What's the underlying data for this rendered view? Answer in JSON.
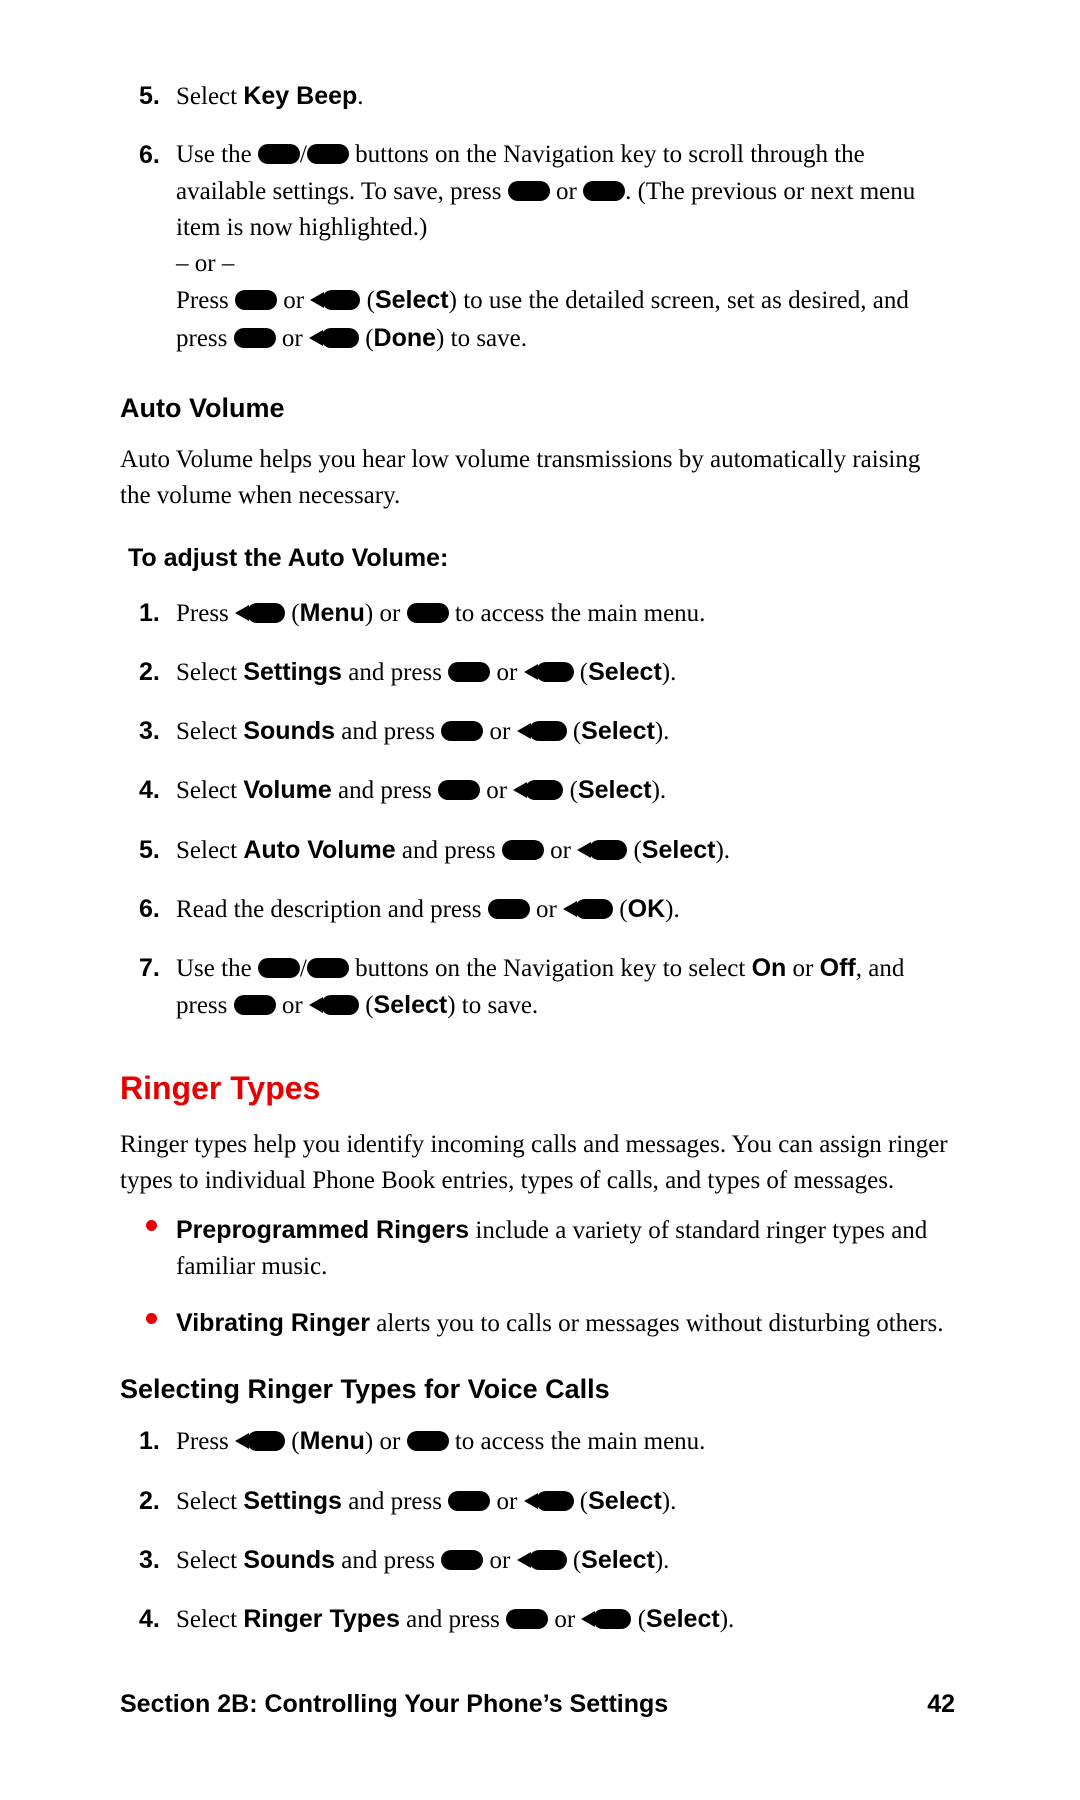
{
  "steps_cont": [
    {
      "n": "5.",
      "parts": [
        "Select ",
        "*Key Beep*",
        "."
      ]
    },
    {
      "n": "6.",
      "parts": [
        "Use the ",
        "@oval",
        "/",
        "@oval",
        " buttons on the Navigation key to scroll through the available settings. To save, press ",
        "@oval",
        " or ",
        "@oval",
        ". (The previous or next menu item is now highlighted.)\n– or –\nPress ",
        "@oval",
        " or ",
        "@nav",
        " (",
        "*Select*",
        ") to use the detailed screen, set as desired, and press ",
        "@oval",
        " or ",
        "@nav",
        " (",
        "*Done*",
        ") to save."
      ]
    }
  ],
  "auto_volume": {
    "heading": "Auto Volume",
    "intro": "Auto Volume helps you hear low volume transmissions by automatically raising the volume when necessary.",
    "task": "To adjust the Auto Volume:",
    "steps": [
      {
        "n": "1.",
        "parts": [
          "Press ",
          "@nav",
          " (",
          "*Menu*",
          ") or ",
          "@oval",
          " to access the main menu."
        ]
      },
      {
        "n": "2.",
        "parts": [
          "Select ",
          "*Settings*",
          " and press ",
          "@oval",
          " or ",
          "@nav",
          " (",
          "*Select*",
          ")."
        ]
      },
      {
        "n": "3.",
        "parts": [
          "Select ",
          "*Sounds*",
          " and press ",
          "@oval",
          " or ",
          "@nav",
          " (",
          "*Select*",
          ")."
        ]
      },
      {
        "n": "4.",
        "parts": [
          "Select ",
          "*Volume*",
          " and press ",
          "@oval",
          " or ",
          "@nav",
          " (",
          "*Select*",
          ")."
        ]
      },
      {
        "n": "5.",
        "parts": [
          "Select ",
          "*Auto Volume*",
          " and press ",
          "@oval",
          " or ",
          "@nav",
          " (",
          "*Select*",
          ")."
        ]
      },
      {
        "n": "6.",
        "parts": [
          "Read the description and press ",
          "@oval",
          " or ",
          "@nav",
          " (",
          "*OK*",
          ")."
        ]
      },
      {
        "n": "7.",
        "parts": [
          "Use the ",
          "@oval",
          "/",
          "@oval",
          " buttons on the Navigation key to select ",
          "*On*",
          " or ",
          "*Off*",
          ", and press ",
          "@oval",
          " or ",
          "@nav",
          " (",
          "*Select*",
          ") to save."
        ]
      }
    ]
  },
  "ringer": {
    "heading": "Ringer Types",
    "intro": "Ringer types help you identify incoming calls and messages. You can assign ringer types to individual Phone Book entries, types of calls, and types of messages.",
    "bullets": [
      [
        "*Preprogrammed Ringers*",
        " include a variety of standard ringer types and familiar music."
      ],
      [
        "*Vibrating Ringer*",
        " alerts you to calls or messages without disturbing others."
      ]
    ],
    "sub_heading": "Selecting Ringer Types for Voice Calls",
    "steps": [
      {
        "n": "1.",
        "parts": [
          "Press ",
          "@nav",
          " (",
          "*Menu*",
          ") or ",
          "@oval",
          " to access the main menu."
        ]
      },
      {
        "n": "2.",
        "parts": [
          "Select ",
          "*Settings*",
          " and press ",
          "@oval",
          " or ",
          "@nav",
          " (",
          "*Select*",
          ")."
        ]
      },
      {
        "n": "3.",
        "parts": [
          "Select ",
          "*Sounds*",
          " and press ",
          "@oval",
          " or ",
          "@nav",
          " (",
          "*Select*",
          ")."
        ]
      },
      {
        "n": "4.",
        "parts": [
          "Select ",
          "*Ringer Types*",
          " and press ",
          "@oval",
          " or ",
          "@nav",
          " (",
          "*Select*",
          ")."
        ]
      }
    ]
  },
  "footer": {
    "section": "Section 2B: Controlling Your Phone’s Settings",
    "page": "42"
  }
}
